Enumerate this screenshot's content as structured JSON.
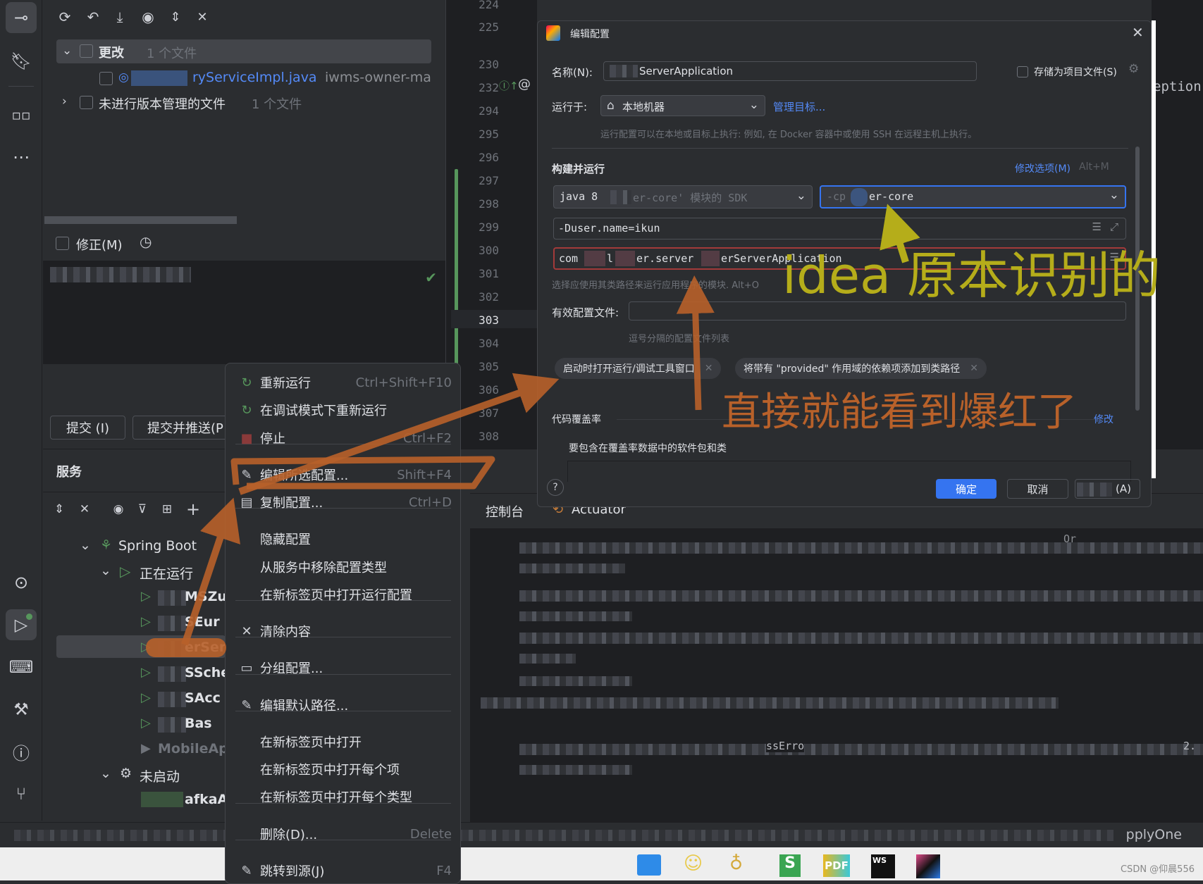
{
  "commit_panel": {
    "changes_group": {
      "label": "更改",
      "count": "1 个文件"
    },
    "changed_file": {
      "name": "ryServiceImpl.java",
      "module": "iwms-owner-ma"
    },
    "unversioned_group": {
      "label": "未进行版本管理的文件",
      "count": "1 个文件"
    },
    "amend_label": "修正(M)",
    "commit_button": "提交 (I)",
    "commit_push_button": "提交并推送(P"
  },
  "editor": {
    "line_numbers": [
      "224",
      "225",
      "230",
      "232",
      "294",
      "295",
      "296",
      "297",
      "298",
      "299",
      "300",
      "301",
      "302",
      "303",
      "304",
      "305",
      "306",
      "307",
      "308"
    ],
    "current_line": "303",
    "visible_text": "eption"
  },
  "services": {
    "title": "服务",
    "tree": {
      "spring_boot": "Spring Boot",
      "running": "正在运行",
      "items": [
        "MSZuu",
        "SEur",
        "erSer",
        "SSche",
        "SAcc",
        "Bas",
        "MobileAp"
      ],
      "not_started": "未启动",
      "not_started_items": [
        "afkaA"
      ]
    },
    "console_tabs": [
      "控制台",
      "Actuator"
    ],
    "console_fragments": [
      "Or",
      "ssErro",
      "2."
    ]
  },
  "context_menu": {
    "items": [
      {
        "label": "重新运行",
        "shortcut": "Ctrl+Shift+F10",
        "icon": "rerun-icon"
      },
      {
        "label": "在调试模式下重新运行",
        "shortcut": "",
        "icon": "rerun-debug-icon"
      },
      {
        "label": "停止",
        "shortcut": "Ctrl+F2",
        "icon": "stop-icon"
      },
      {
        "label": "编辑所选配置...",
        "shortcut": "Shift+F4",
        "icon": "pencil-icon"
      },
      {
        "label": "复制配置...",
        "shortcut": "Ctrl+D",
        "icon": "copy-icon"
      },
      {
        "label": "隐藏配置",
        "shortcut": "",
        "icon": ""
      },
      {
        "label": "从服务中移除配置类型",
        "shortcut": "",
        "icon": ""
      },
      {
        "label": "在新标签页中打开运行配置",
        "shortcut": "",
        "icon": ""
      },
      {
        "label": "清除内容",
        "shortcut": "",
        "icon": "close-icon"
      },
      {
        "label": "分组配置...",
        "shortcut": "",
        "icon": "folder-icon"
      },
      {
        "label": "编辑默认路径...",
        "shortcut": "",
        "icon": "pencil-icon"
      },
      {
        "label": "在新标签页中打开",
        "shortcut": "",
        "icon": ""
      },
      {
        "label": "在新标签页中打开每个项",
        "shortcut": "",
        "icon": ""
      },
      {
        "label": "在新标签页中打开每个类型",
        "shortcut": "",
        "icon": ""
      },
      {
        "label": "删除(D)...",
        "shortcut": "Delete",
        "icon": ""
      },
      {
        "label": "跳转到源(J)",
        "shortcut": "F4",
        "icon": "pencil-icon"
      }
    ]
  },
  "dialog": {
    "title": "编辑配置",
    "name_label": "名称(N):",
    "name_value": "ServerApplication",
    "store_as_file": "存储为项目文件(S)",
    "run_on_label": "运行于:",
    "run_on_value": "本地机器",
    "manage_targets": "管理目标...",
    "run_on_hint": "运行配置可以在本地或目标上执行: 例如, 在 Docker 容器中或使用 SSH 在远程主机上执行。",
    "build_run_title": "构建并运行",
    "modify_options": "修改选项(M)",
    "modify_shortcut": "Alt+M",
    "jdk_value": "java 8",
    "jdk_hint": "er-core' 模块的 SDK",
    "cp_prefix": "-cp",
    "cp_value": "er-core",
    "vm_options": "-Duser.name=ikun",
    "main_class": {
      "a": "com",
      "b": "l",
      "c": "er.server",
      "d": "erServerApplication"
    },
    "module_hint": "选择应使用其类路径来运行应用程序的模块. Alt+O",
    "active_profiles_label": "有效配置文件:",
    "active_profiles_hint": "逗号分隔的配置文件列表",
    "chips": [
      "启动时打开运行/调试工具窗口",
      "将带有 \"provided\" 作用域的依赖项添加到类路径"
    ],
    "coverage_title": "代码覆盖率",
    "coverage_modify": "修改",
    "coverage_include": "要包含在覆盖率数据中的软件包和类",
    "ok": "确定",
    "cancel": "取消",
    "apply": "(A)"
  },
  "annotations": {
    "yellow_text": "idea 原本识别的",
    "orange_text": "直接就能看到爆红了",
    "orange": "#b8612a",
    "yellow": "#b5ad1a"
  },
  "status_bar": {
    "right_text": "pplyOne"
  },
  "taskbar": {
    "watermark": "CSDN @仰晨556",
    "apps": [
      "windows-icon",
      "app-icon",
      "app-icon",
      "wps-sheet-icon",
      "pdf-icon",
      "webstorm-icon",
      "jetbrains-icon"
    ]
  },
  "colors": {
    "accent": "#3574f0",
    "bg": "#2b2d30",
    "error_border": "#a33a3a",
    "success": "#57965c"
  }
}
